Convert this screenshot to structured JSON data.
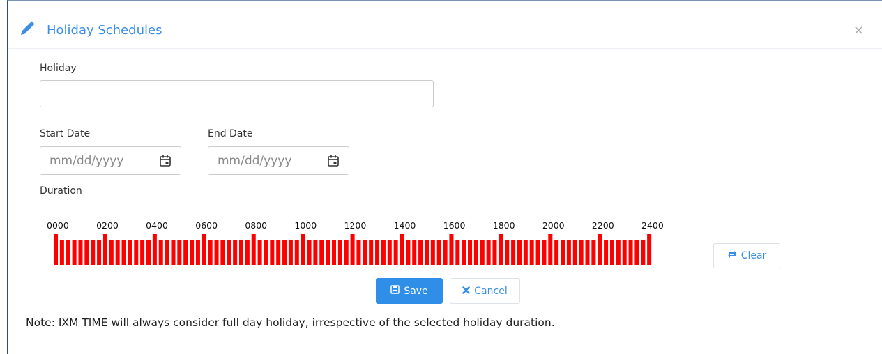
{
  "header": {
    "title": "Holiday Schedules",
    "close_label": "×",
    "icon": "pencil-icon",
    "accent": "#3a8ee6"
  },
  "form": {
    "holiday_label": "Holiday",
    "holiday_value": "",
    "start_date_label": "Start Date",
    "start_date_placeholder": "mm/dd/yyyy",
    "end_date_label": "End Date",
    "end_date_placeholder": "mm/dd/yyyy",
    "duration_label": "Duration"
  },
  "duration": {
    "tick_labels": [
      "0000",
      "0200",
      "0400",
      "0600",
      "0800",
      "1000",
      "1200",
      "1400",
      "1600",
      "1800",
      "2000",
      "2200",
      "2400"
    ],
    "bar_count": 97,
    "bar_color": "#ff0000",
    "all_selected": true
  },
  "buttons": {
    "clear_label": "Clear",
    "save_label": "Save",
    "cancel_label": "Cancel"
  },
  "note": "Note: IXM TIME will always consider full day holiday, irrespective of the selected holiday duration."
}
